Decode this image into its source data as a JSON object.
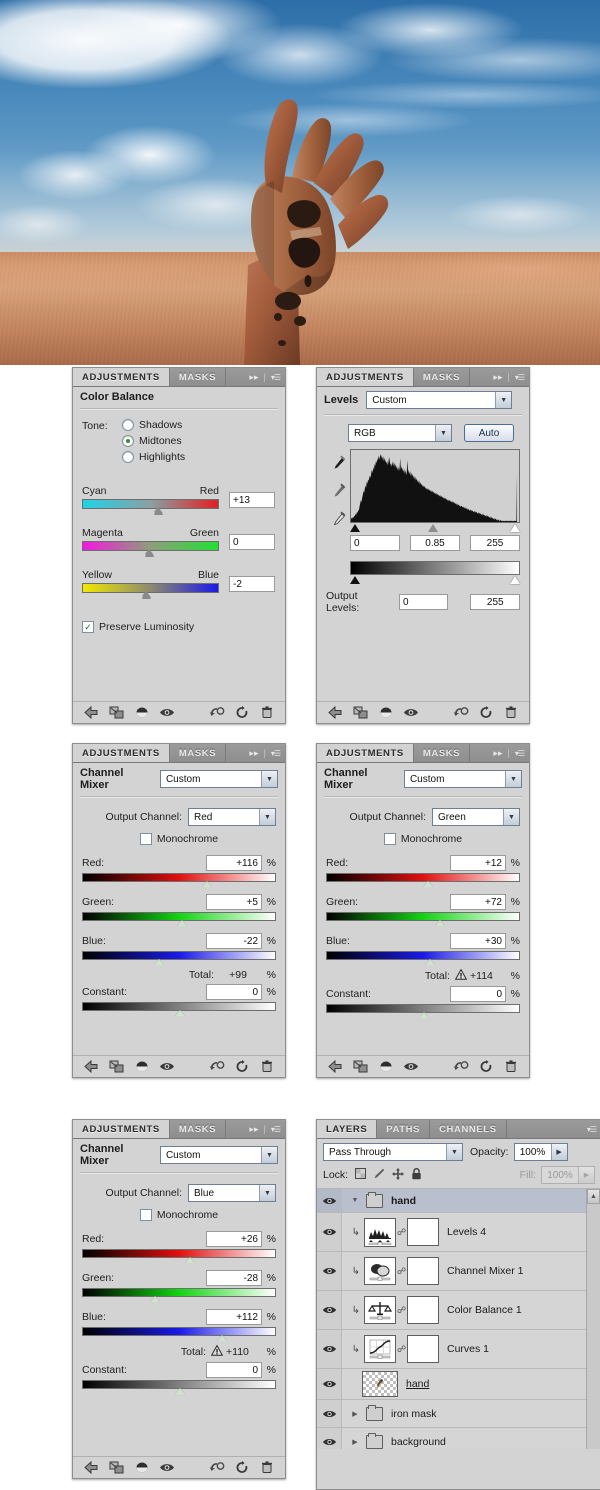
{
  "artwork": {
    "title": "rusty metal hand rising from desert sand under cloudy sky",
    "alt": "Photo composite: a corroded iron hand emerging from a sand dune"
  },
  "panels": {
    "color_balance": {
      "tabs": [
        {
          "label": "ADJUSTMENTS",
          "active": true
        },
        {
          "label": "MASKS",
          "active": false
        }
      ],
      "title": "Color Balance",
      "tone_label": "Tone:",
      "tone_options": [
        {
          "label": "Shadows",
          "selected": false
        },
        {
          "label": "Midtones",
          "selected": true
        },
        {
          "label": "Highlights",
          "selected": false
        }
      ],
      "sliders": [
        {
          "left_label": "Cyan",
          "right_label": "Red",
          "value": "+13",
          "pos": 57
        },
        {
          "left_label": "Magenta",
          "right_label": "Green",
          "value": "0",
          "pos": 50
        },
        {
          "left_label": "Yellow",
          "right_label": "Blue",
          "value": "-2",
          "pos": 48
        }
      ],
      "preserve_luminosity": {
        "label": "Preserve Luminosity",
        "checked": true
      }
    },
    "levels": {
      "tabs": [
        {
          "label": "ADJUSTMENTS",
          "active": true
        },
        {
          "label": "MASKS",
          "active": false
        }
      ],
      "title": "Levels",
      "preset": "Custom",
      "channel": "RGB",
      "auto_label": "Auto",
      "input_levels": [
        "0",
        "0.85",
        "255"
      ],
      "output_levels_label": "Output Levels:",
      "output_levels": [
        "0",
        "255"
      ],
      "histogram": [
        4,
        6,
        5,
        7,
        6,
        9,
        8,
        12,
        10,
        14,
        13,
        17,
        16,
        22,
        26,
        31,
        28,
        34,
        38,
        44,
        41,
        47,
        52,
        48,
        57,
        54,
        60,
        58,
        63,
        66,
        62,
        70,
        74,
        69,
        78,
        73,
        82,
        79,
        86,
        83,
        90,
        86,
        94,
        88,
        92,
        96,
        90,
        95,
        88,
        93,
        86,
        91,
        84,
        88,
        82,
        86,
        80,
        84,
        92,
        86,
        80,
        83,
        78,
        82,
        86,
        79,
        84,
        77,
        82,
        75,
        80,
        73,
        78,
        72,
        76,
        90,
        74,
        79,
        72,
        77,
        70,
        75,
        68,
        73,
        66,
        71,
        88,
        69,
        74,
        67,
        72,
        65,
        70,
        64,
        68,
        62,
        66,
        60,
        64,
        58,
        62,
        56,
        60,
        55,
        58,
        53,
        56,
        52,
        54,
        50,
        52,
        49,
        51,
        47,
        49,
        46,
        48,
        45,
        47,
        44,
        46,
        43,
        45,
        42,
        44,
        41,
        43,
        40,
        42,
        39,
        41,
        38,
        40,
        37,
        39,
        36,
        38,
        35,
        37,
        34,
        36,
        33,
        35,
        32,
        34,
        31,
        33,
        30,
        32,
        29,
        31,
        30,
        29,
        28,
        30,
        27,
        29,
        26,
        28,
        25,
        27,
        24,
        26,
        23,
        25,
        22,
        24,
        21,
        23,
        22,
        21,
        20,
        22,
        19,
        21,
        18,
        20,
        17,
        19,
        18,
        17,
        16,
        18,
        15,
        17,
        16,
        15,
        14,
        16,
        13,
        15,
        14,
        13,
        12,
        14,
        11,
        13,
        12,
        11,
        10,
        12,
        9,
        11,
        10,
        9,
        8,
        10,
        7,
        9,
        8,
        7,
        6,
        8,
        5,
        7,
        6,
        5,
        4,
        6,
        3,
        5,
        4,
        3,
        2,
        4,
        3,
        2,
        1,
        3,
        2,
        1,
        2,
        1,
        2,
        1,
        2,
        1,
        2,
        1,
        2,
        1,
        2,
        1,
        2,
        1,
        2,
        1,
        2,
        1,
        2,
        1,
        2,
        1,
        70
      ]
    },
    "channel_mixer_red": {
      "tabs": [
        {
          "label": "ADJUSTMENTS",
          "active": true
        },
        {
          "label": "MASKS",
          "active": false
        }
      ],
      "title": "Channel Mixer",
      "preset": "Custom",
      "output_channel_label": "Output Channel:",
      "output_channel": "Red",
      "monochrome": {
        "label": "Monochrome",
        "checked": false
      },
      "sliders": [
        {
          "label": "Red:",
          "value": "+116",
          "unit": "%",
          "pos": 64
        },
        {
          "label": "Green:",
          "value": "+5",
          "unit": "%",
          "pos": 51
        },
        {
          "label": "Blue:",
          "value": "-22",
          "unit": "%",
          "pos": 39
        }
      ],
      "total_label": "Total:",
      "total_value": "+99",
      "total_unit": "%",
      "total_warning": false,
      "constant": {
        "label": "Constant:",
        "value": "0",
        "unit": "%",
        "pos": 50
      }
    },
    "channel_mixer_green": {
      "tabs": [
        {
          "label": "ADJUSTMENTS",
          "active": true
        },
        {
          "label": "MASKS",
          "active": false
        }
      ],
      "title": "Channel Mixer",
      "preset": "Custom",
      "output_channel_label": "Output Channel:",
      "output_channel": "Green",
      "monochrome": {
        "label": "Monochrome",
        "checked": false
      },
      "sliders": [
        {
          "label": "Red:",
          "value": "+12",
          "unit": "%",
          "pos": 52
        },
        {
          "label": "Green:",
          "value": "+72",
          "unit": "%",
          "pos": 58
        },
        {
          "label": "Blue:",
          "value": "+30",
          "unit": "%",
          "pos": 53
        }
      ],
      "total_label": "Total:",
      "total_value": "+114",
      "total_unit": "%",
      "total_warning": true,
      "constant": {
        "label": "Constant:",
        "value": "0",
        "unit": "%",
        "pos": 50
      }
    },
    "channel_mixer_blue": {
      "tabs": [
        {
          "label": "ADJUSTMENTS",
          "active": true
        },
        {
          "label": "MASKS",
          "active": false
        }
      ],
      "title": "Channel Mixer",
      "preset": "Custom",
      "output_channel_label": "Output Channel:",
      "output_channel": "Blue",
      "monochrome": {
        "label": "Monochrome",
        "checked": false
      },
      "sliders": [
        {
          "label": "Red:",
          "value": "+26",
          "unit": "%",
          "pos": 55
        },
        {
          "label": "Green:",
          "value": "-28",
          "unit": "%",
          "pos": 37
        },
        {
          "label": "Blue:",
          "value": "+112",
          "unit": "%",
          "pos": 72
        }
      ],
      "total_label": "Total:",
      "total_value": "+110",
      "total_unit": "%",
      "total_warning": true,
      "constant": {
        "label": "Constant:",
        "value": "0",
        "unit": "%",
        "pos": 50
      }
    },
    "layers": {
      "tabs": [
        {
          "label": "LAYERS",
          "active": true
        },
        {
          "label": "PATHS",
          "active": false
        },
        {
          "label": "CHANNELS",
          "active": false
        }
      ],
      "blend_mode": "Pass Through",
      "opacity_label": "Opacity:",
      "opacity_value": "100%",
      "lock_label": "Lock:",
      "lock_icons": [
        "transparency-lock-icon",
        "paint-lock-icon",
        "move-lock-icon",
        "all-lock-icon"
      ],
      "fill_label": "Fill:",
      "fill_value": "100%",
      "rows": [
        {
          "name": "hand",
          "kind": "group",
          "expanded": true,
          "selected": true,
          "indent": 0,
          "visible": true,
          "thumb": "folder-icon"
        },
        {
          "name": "Levels 4",
          "kind": "adjust",
          "indent": 1,
          "visible": true,
          "thumb": "levels-thumb",
          "has_mask": true,
          "linked": true
        },
        {
          "name": "Channel Mixer 1",
          "kind": "adjust",
          "indent": 1,
          "visible": true,
          "thumb": "channel-mixer-thumb",
          "has_mask": true,
          "linked": true
        },
        {
          "name": "Color Balance 1",
          "kind": "adjust",
          "indent": 1,
          "visible": true,
          "thumb": "color-balance-thumb",
          "has_mask": true,
          "linked": true
        },
        {
          "name": "Curves 1",
          "kind": "adjust",
          "indent": 1,
          "visible": true,
          "thumb": "curves-thumb",
          "has_mask": true,
          "linked": true
        },
        {
          "name": "hand",
          "kind": "pixel",
          "indent": 0,
          "visible": true,
          "thumb": "transparent-thumb",
          "underlined": true
        },
        {
          "name": "iron mask",
          "kind": "group",
          "expanded": false,
          "indent": 0,
          "visible": true,
          "thumb": "folder-icon"
        },
        {
          "name": "background",
          "kind": "group",
          "expanded": false,
          "indent": 0,
          "visible": true,
          "thumb": "folder-icon"
        }
      ]
    }
  },
  "footer_tools": [
    "previous-state-icon",
    "clip-to-layer-icon",
    "toggle-mask-icon",
    "preview-eye-icon",
    "reset-sample-icon",
    "reset-icon",
    "delete-icon"
  ],
  "colors": {
    "panel_bg": "#d3d3d3",
    "tab_bar": "#909090",
    "selected_row": "#b9bfcd",
    "accent_green": "#3b7a3b",
    "button_border": "#4d6d96"
  }
}
